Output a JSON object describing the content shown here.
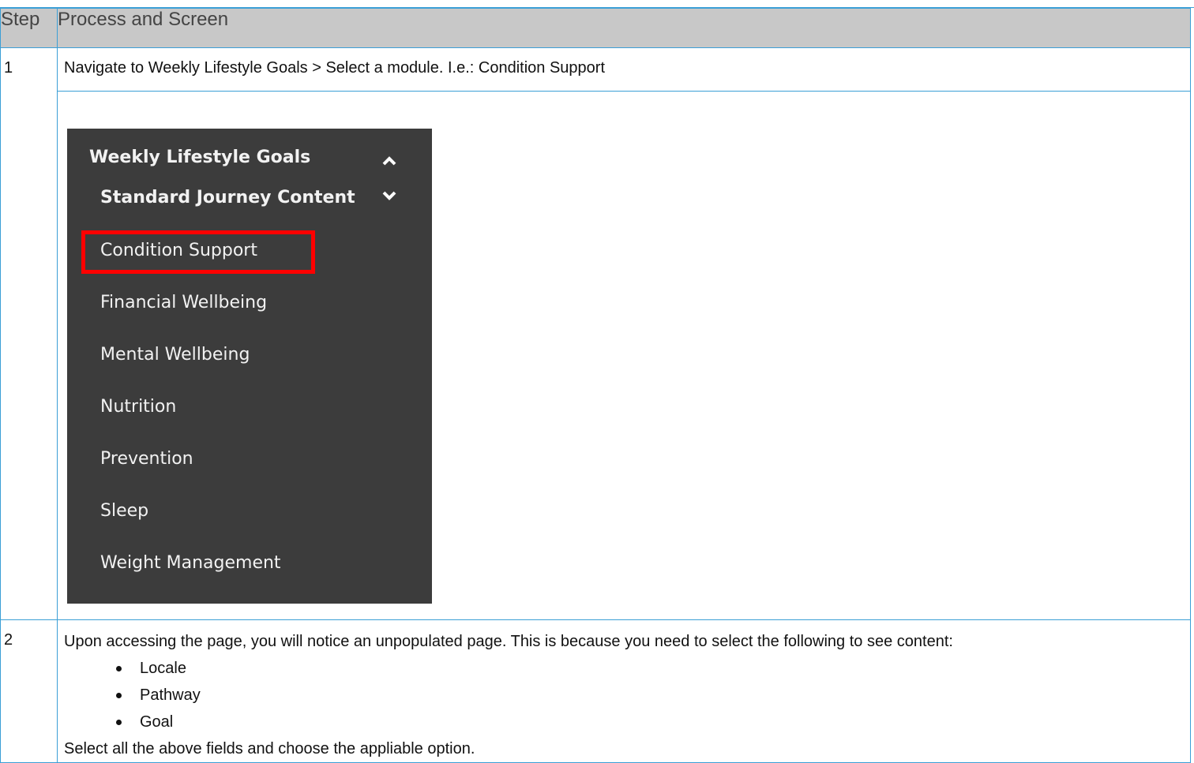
{
  "table": {
    "header": {
      "step": "Step",
      "process": "Process and Screen"
    },
    "rows": [
      {
        "step": "1",
        "instruction": "Navigate to Weekly Lifestyle Goals > Select a module. I.e.: Condition Support"
      },
      {
        "step": "2",
        "intro": "Upon accessing the page, you will notice an unpopulated page. This is because you need to select the following to see content:",
        "bullets": [
          "Locale",
          "Pathway",
          "Goal"
        ],
        "outro": "Select all the above fields and choose the appliable option."
      }
    ]
  },
  "nav_screenshot": {
    "section_title": "Weekly Lifestyle Goals",
    "section_icon": "chevron-up-icon",
    "subsection_title": "Standard Journey Content",
    "subsection_icon": "chevron-down-icon",
    "items": [
      "Condition Support",
      "Financial Wellbeing",
      "Mental Wellbeing",
      "Nutrition",
      "Prevention",
      "Sleep",
      "Weight Management"
    ],
    "highlighted_item": "Condition Support",
    "colors": {
      "background": "#3c3c3c",
      "text": "#f2f2f2",
      "highlight": "#ff0000",
      "table_border": "#3b9fd6",
      "header_bg": "#c8c8c8"
    }
  }
}
